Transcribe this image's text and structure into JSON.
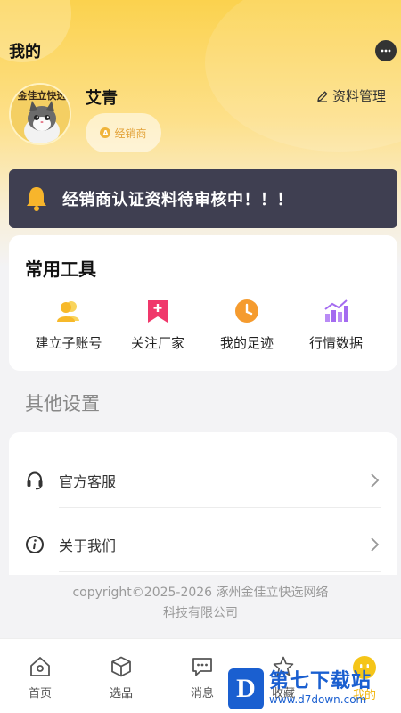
{
  "header": {
    "title": "我的",
    "chat_icon": "chat-bubble-icon"
  },
  "profile": {
    "avatar_caption": "金佳立快选",
    "name": "艾青",
    "role": "经销商",
    "manage_label": "资料管理"
  },
  "notice": {
    "text": "经销商认证资料待审核中！！！"
  },
  "tools": {
    "title": "常用工具",
    "items": [
      {
        "label": "建立子账号",
        "icon": "users-icon",
        "color": "#f7c233"
      },
      {
        "label": "关注厂家",
        "icon": "bookmark-plus-icon",
        "color": "#f0386b"
      },
      {
        "label": "我的足迹",
        "icon": "clock-icon",
        "color": "#f59b2e"
      },
      {
        "label": "行情数据",
        "icon": "bar-chart-icon",
        "color": "#a46bf0"
      }
    ]
  },
  "other_settings": {
    "title": "其他设置",
    "items": [
      {
        "label": "官方客服",
        "icon": "headset-icon"
      },
      {
        "label": "关于我们",
        "icon": "info-icon"
      }
    ]
  },
  "footer": {
    "copyright_line1": "copyright©2025-2026 涿州金佳立快选网络",
    "copyright_line2": "科技有限公司"
  },
  "tabbar": {
    "items": [
      {
        "label": "首页",
        "icon": "home-icon"
      },
      {
        "label": "选品",
        "icon": "cube-icon"
      },
      {
        "label": "消息",
        "icon": "message-icon"
      },
      {
        "label": "收藏",
        "icon": "star-icon"
      },
      {
        "label": "我的",
        "icon": "profile-face-icon"
      }
    ],
    "active_index": 4,
    "accent": "#f0b40a"
  },
  "watermark": {
    "logo_letter": "D",
    "title": "第七下载站",
    "url": "www.d7down.com"
  }
}
